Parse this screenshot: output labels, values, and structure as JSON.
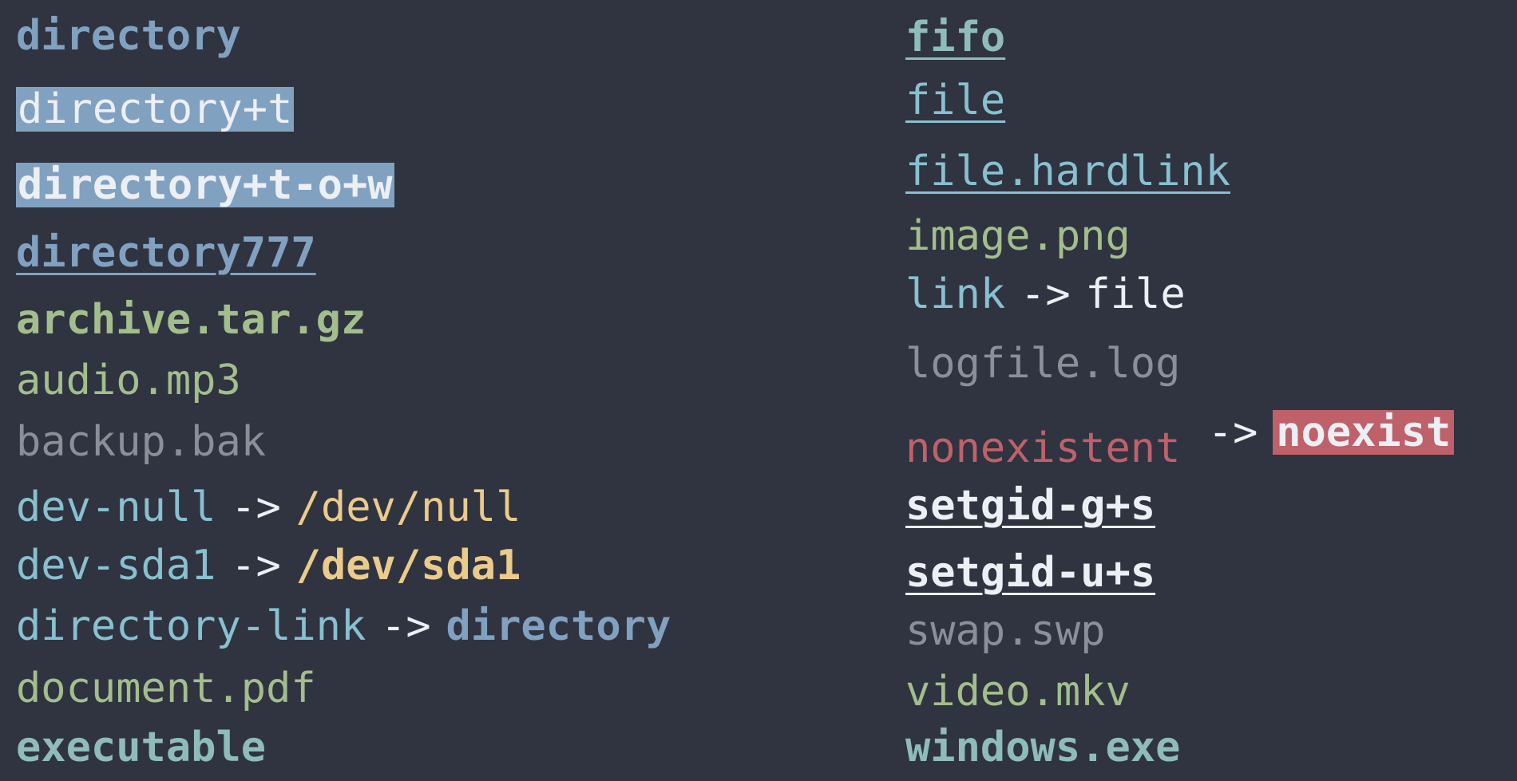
{
  "listing": {
    "arrow": "->",
    "left": [
      {
        "name": "directory"
      },
      {
        "name": "directory+t"
      },
      {
        "name": "directory+t-o+w"
      },
      {
        "name": "directory777"
      },
      {
        "name": "archive.tar.gz"
      },
      {
        "name": "audio.mp3"
      },
      {
        "name": "backup.bak"
      },
      {
        "name": "dev-null",
        "target": "/dev/null"
      },
      {
        "name": "dev-sda1",
        "target": "/dev/sda1"
      },
      {
        "name": "directory-link",
        "target": "directory"
      },
      {
        "name": "document.pdf"
      },
      {
        "name": "executable"
      }
    ],
    "right": [
      {
        "name": "fifo"
      },
      {
        "name": "file"
      },
      {
        "name": "file.hardlink"
      },
      {
        "name": "image.png"
      },
      {
        "name": "link",
        "target": "file"
      },
      {
        "name": "logfile.log"
      },
      {
        "name": "nonexistent",
        "target": "noexist"
      },
      {
        "name": "setgid-g+s"
      },
      {
        "name": "setgid-u+s"
      },
      {
        "name": "swap.swp"
      },
      {
        "name": "video.mkv"
      },
      {
        "name": "windows.exe"
      }
    ]
  },
  "colors": {
    "background": "#2f3440",
    "directory": "#81a1c1",
    "archive_media": "#a3be8c",
    "dim": "#8a8f99",
    "symlink": "#88c0d0",
    "device": "#ebcb8b",
    "broken": "#bf616a",
    "executable": "#8fbcbb"
  }
}
